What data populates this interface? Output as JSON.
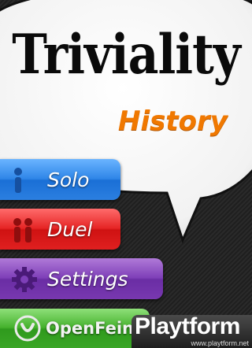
{
  "app": {
    "title": "Triviality",
    "subtitle": "History"
  },
  "menu": {
    "solo": {
      "label": "Solo",
      "icon": "single-person-icon",
      "color": "#2f86e8"
    },
    "duel": {
      "label": "Duel",
      "icon": "two-people-icon",
      "color": "#e62525"
    },
    "settings": {
      "label": "Settings",
      "icon": "gear-icon",
      "color": "#7e3fb8"
    },
    "openfeint": {
      "label": "OpenFeint",
      "icon": "openfeint-logo-icon",
      "color": "#45b12d"
    }
  },
  "watermark": {
    "brand": "Playtform",
    "site": "www.playtform.net"
  },
  "colors": {
    "subtitle": "#f07800",
    "background": "#252525",
    "bubble": "#ffffff"
  }
}
